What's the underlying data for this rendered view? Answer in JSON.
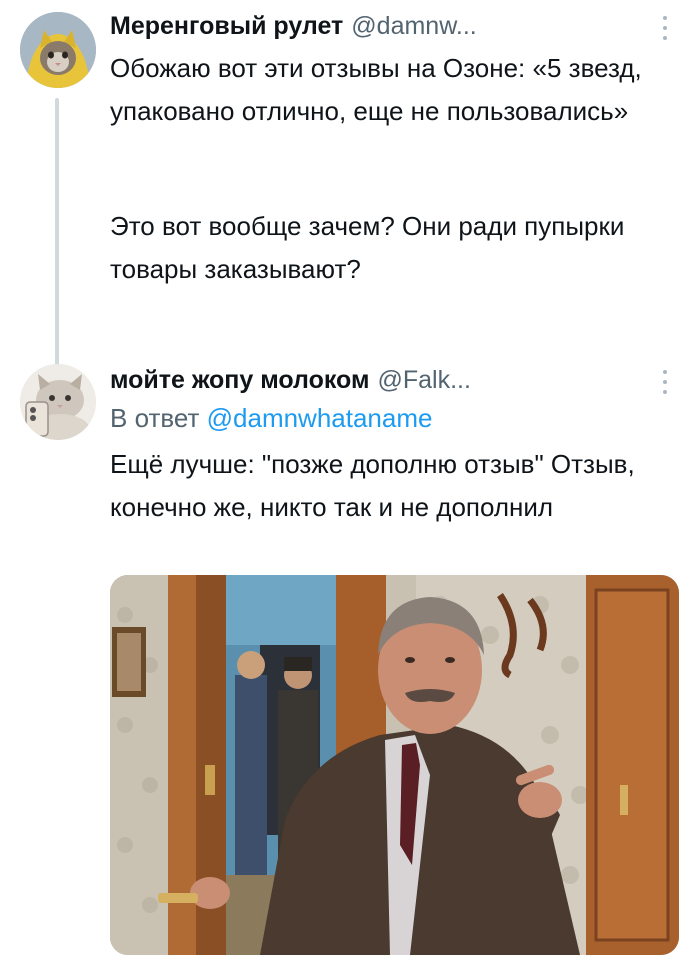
{
  "tweets": [
    {
      "author_name": "Меренговый рулет",
      "author_handle": "@damnw...",
      "avatar_icon": "cat-in-yellow-hood-avatar-icon",
      "more_icon": "vertical-ellipsis-icon",
      "text_p1": "Обожаю вот эти отзывы на Озоне: «5 звезд, упаковано отлично, еще не пользовались»",
      "text_p2": "Это вот вообще зачем? Они ради пупырки товары заказывают?"
    },
    {
      "author_name": "мойте жопу молоком",
      "author_handle": "@Falk...",
      "avatar_icon": "cat-with-phone-avatar-icon",
      "more_icon": "vertical-ellipsis-icon",
      "reply_prefix": "В ответ",
      "reply_handle": "@damnwhataname",
      "text": "Ещё лучше: \"позже дополню отзыв\" Отзыв, конечно же, никто так и не дополнил",
      "media_icon": "photo-man-pointing-in-doorway-icon"
    }
  ],
  "colors": {
    "text": "#0f1419",
    "secondary": "#536471",
    "link": "#1d9bf0",
    "thread_line": "#cfd9de"
  }
}
